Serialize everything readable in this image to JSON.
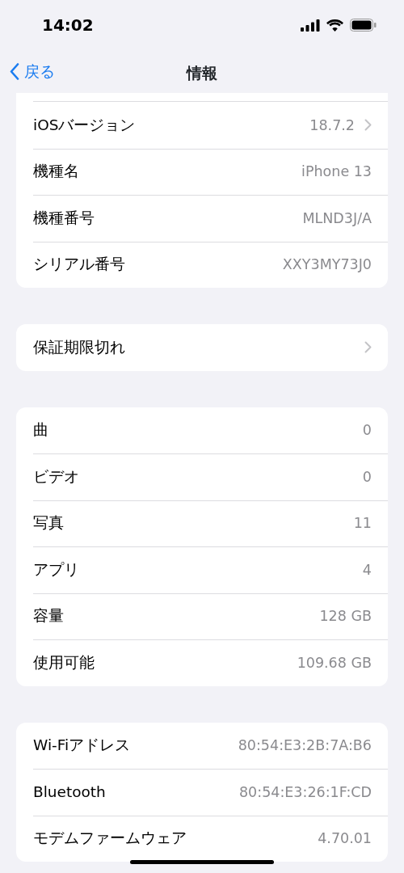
{
  "status_bar": {
    "time": "14:02"
  },
  "nav": {
    "back": "戻る",
    "title": "情報"
  },
  "groups": [
    {
      "cut_top": true,
      "rows": [
        {
          "label": "iOSバージョン",
          "value": "18.7.2",
          "chevron": true
        },
        {
          "label": "機種名",
          "value": "iPhone 13",
          "chevron": false
        },
        {
          "label": "機種番号",
          "value": "MLND3J/A",
          "chevron": false
        },
        {
          "label": "シリアル番号",
          "value": "XXY3MY73J0",
          "chevron": false
        }
      ]
    },
    {
      "cut_top": false,
      "rows": [
        {
          "label": "保証期限切れ",
          "chevron": true
        }
      ]
    },
    {
      "cut_top": false,
      "rows": [
        {
          "label": "曲",
          "value": "0",
          "chevron": false
        },
        {
          "label": "ビデオ",
          "value": "0",
          "chevron": false
        },
        {
          "label": "写真",
          "value": "11",
          "chevron": false
        },
        {
          "label": "アプリ",
          "value": "4",
          "chevron": false
        },
        {
          "label": "容量",
          "value": "128 GB",
          "chevron": false
        },
        {
          "label": "使用可能",
          "value": "109.68 GB",
          "chevron": false
        }
      ]
    },
    {
      "cut_top": false,
      "rows": [
        {
          "label": "Wi-Fiアドレス",
          "value": "80:54:E3:2B:7A:B6",
          "chevron": false
        },
        {
          "label": "Bluetooth",
          "value": "80:54:E3:26:1F:CD",
          "chevron": false
        },
        {
          "label": "モデムファームウェア",
          "value": "4.70.01",
          "chevron": false
        }
      ]
    }
  ]
}
